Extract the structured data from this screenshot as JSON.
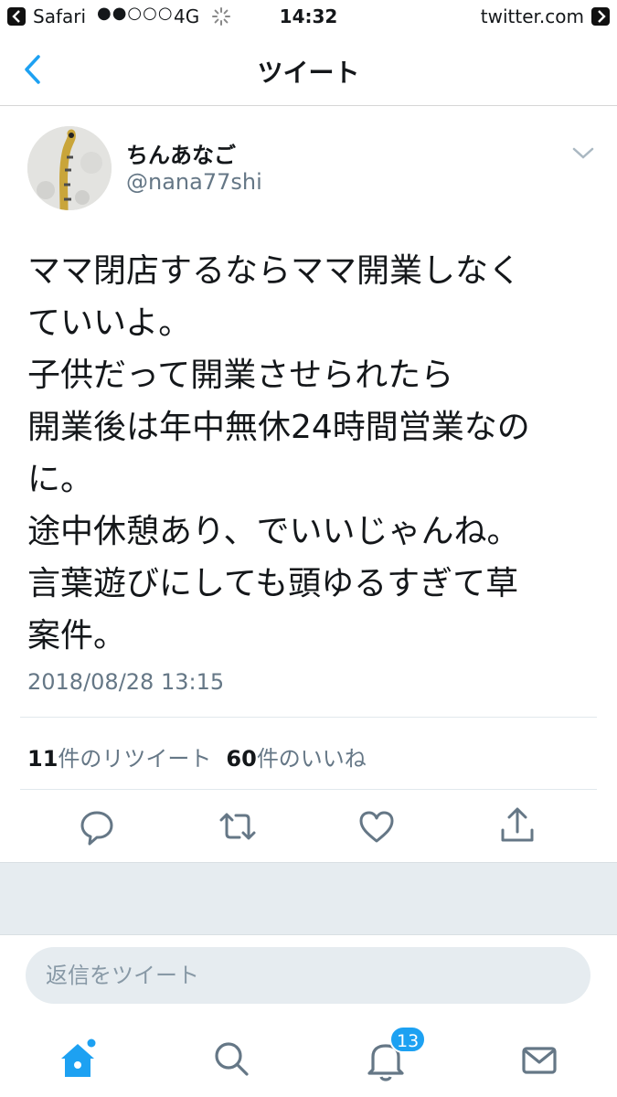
{
  "status_bar": {
    "app": "Safari",
    "signal": "●●○○○",
    "network": "4G",
    "time": "14:32",
    "host": "twitter.com"
  },
  "nav": {
    "title": "ツイート",
    "back_icon": "chevron-left-icon"
  },
  "tweet": {
    "display_name": "ちんあなご",
    "handle": "@nana77shi",
    "lines": [
      "ママ閉店するならママ開業しなく",
      "ていいよ。",
      "子供だって開業させられたら",
      "開業後は年中無休24時間営業なの",
      "に。",
      "途中休憩あり、でいいじゃんね。",
      "言葉遊びにしても頭ゆるすぎて草",
      "案件。"
    ],
    "timestamp": "2018/08/28 13:15"
  },
  "stats": {
    "retweet_count": "11",
    "retweet_label": "件のリツイート",
    "like_count": "60",
    "like_label": "件のいいね"
  },
  "actions": [
    "reply-icon",
    "retweet-icon",
    "heart-icon",
    "share-icon"
  ],
  "reply": {
    "placeholder": "返信をツイート"
  },
  "tabbar": {
    "items": [
      "home-icon",
      "search-icon",
      "notifications-icon",
      "messages-icon"
    ],
    "notification_badge": "13"
  },
  "colors": {
    "accent": "#1da1f2",
    "text_primary": "#14171a",
    "text_secondary": "#657786",
    "divider": "#e1e8ed",
    "band": "#e6ecf0"
  }
}
